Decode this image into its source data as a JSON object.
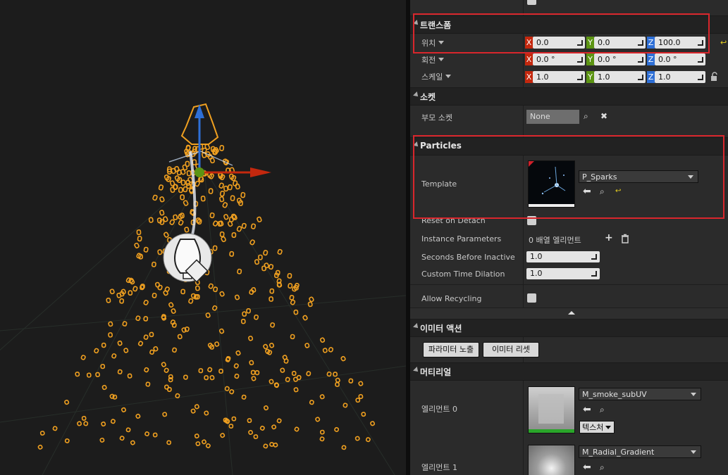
{
  "sections": {
    "transform": {
      "title": "트랜스폼",
      "rows": [
        {
          "label": "위치",
          "x": "0.0",
          "y": "0.0",
          "z": "100.0"
        },
        {
          "label": "회전",
          "x": "0.0 °",
          "y": "0.0 °",
          "z": "0.0 °"
        },
        {
          "label": "스케일",
          "x": "1.0",
          "y": "1.0",
          "z": "1.0"
        }
      ],
      "axes": {
        "x": "X",
        "y": "Y",
        "z": "Z"
      }
    },
    "socket": {
      "title": "소켓",
      "parent_socket_label": "부모 소켓",
      "parent_socket_value": "None"
    },
    "particles": {
      "title": "Particles",
      "template_label": "Template",
      "template_value": "P_Sparks",
      "reset_on_detach_label": "Reset on Detach",
      "instance_parameters_label": "Instance Parameters",
      "instance_parameters_value": "0 배열 엘리먼트",
      "seconds_before_inactive_label": "Seconds Before Inactive",
      "seconds_before_inactive_value": "1.0",
      "custom_time_dilation_label": "Custom Time Dilation",
      "custom_time_dilation_value": "1.0",
      "allow_recycling_label": "Allow Recycling"
    },
    "emitter_actions": {
      "title": "이미터 액션",
      "expose_params_button": "파라미터 노출",
      "reset_emitter_button": "이미터 리셋"
    },
    "materials": {
      "title": "머티리얼",
      "elements": [
        {
          "label": "엘리먼트 0",
          "value": "M_smoke_subUV",
          "texture_button": "텍스처"
        },
        {
          "label": "엘리먼트 1",
          "value": "M_Radial_Gradient"
        }
      ]
    }
  },
  "colors": {
    "highlight": "#d9262c",
    "axis_x": "#c4280e",
    "axis_y": "#5c9413",
    "axis_z": "#2e6fd6",
    "particle_outline": "#f0a020"
  },
  "icons": [
    "reset-arrow-icon",
    "browse-icon",
    "clear-icon",
    "add-icon",
    "trash-icon",
    "lock-icon",
    "collapse-up-icon"
  ]
}
